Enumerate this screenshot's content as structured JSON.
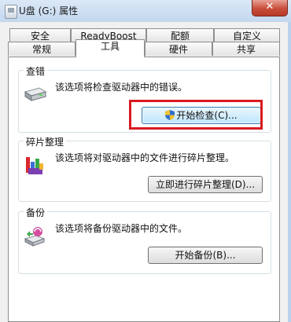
{
  "window": {
    "title": "U盘 (G:) 属性",
    "close_label": "✕"
  },
  "tabs": {
    "row1": [
      "安全",
      "ReadyBoost",
      "配额",
      "自定义"
    ],
    "row2": [
      "常规",
      "工具",
      "硬件",
      "共享"
    ],
    "active": "工具"
  },
  "error_check": {
    "label": "查错",
    "description": "该选项将检查驱动器中的错误。",
    "button": "开始检查(C)..."
  },
  "defrag": {
    "label": "碎片整理",
    "description": "该选项将对驱动器中的文件进行碎片整理。",
    "button": "立即进行碎片整理(D)..."
  },
  "backup": {
    "label": "备份",
    "description": "该选项将备份驱动器中的文件。",
    "button": "开始备份(B)..."
  },
  "icons": {
    "drive": "disk-drive-icon",
    "defrag": "defrag-icon",
    "backup": "backup-icon",
    "shield": "uac-shield-icon"
  },
  "colors": {
    "highlight": "#d81b21",
    "titlebar": "#c3d7ee",
    "close": "#c84d3a"
  }
}
